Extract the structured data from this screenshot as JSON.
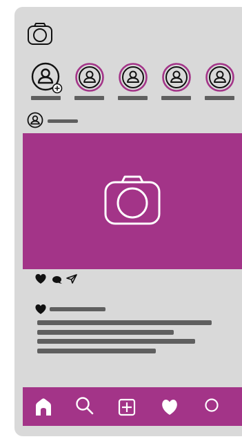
{
  "colors": {
    "background": "#d9d9d9",
    "accent": "#a33488",
    "placeholder_bar": "#5f5f5f",
    "icon": "#111111",
    "nav_icon": "#ffffff"
  },
  "header": {
    "logo_icon": "camera-icon"
  },
  "stories": {
    "items": [
      {
        "icon": "user-icon",
        "badge_icon": "plus-circle-icon",
        "own": true
      },
      {
        "icon": "user-icon",
        "own": false
      },
      {
        "icon": "user-icon",
        "own": false
      },
      {
        "icon": "user-icon",
        "own": false
      },
      {
        "icon": "user-icon",
        "own": false
      }
    ]
  },
  "post": {
    "author_icon": "user-icon",
    "image_icon": "camera-icon",
    "actions": [
      "heart-icon",
      "comment-icon",
      "send-icon"
    ],
    "likes_icon": "heart-icon",
    "caption_lines": 4
  },
  "bottom_nav": {
    "items": [
      "home-icon",
      "search-icon",
      "add-icon",
      "heart-icon",
      "profile-icon"
    ]
  }
}
